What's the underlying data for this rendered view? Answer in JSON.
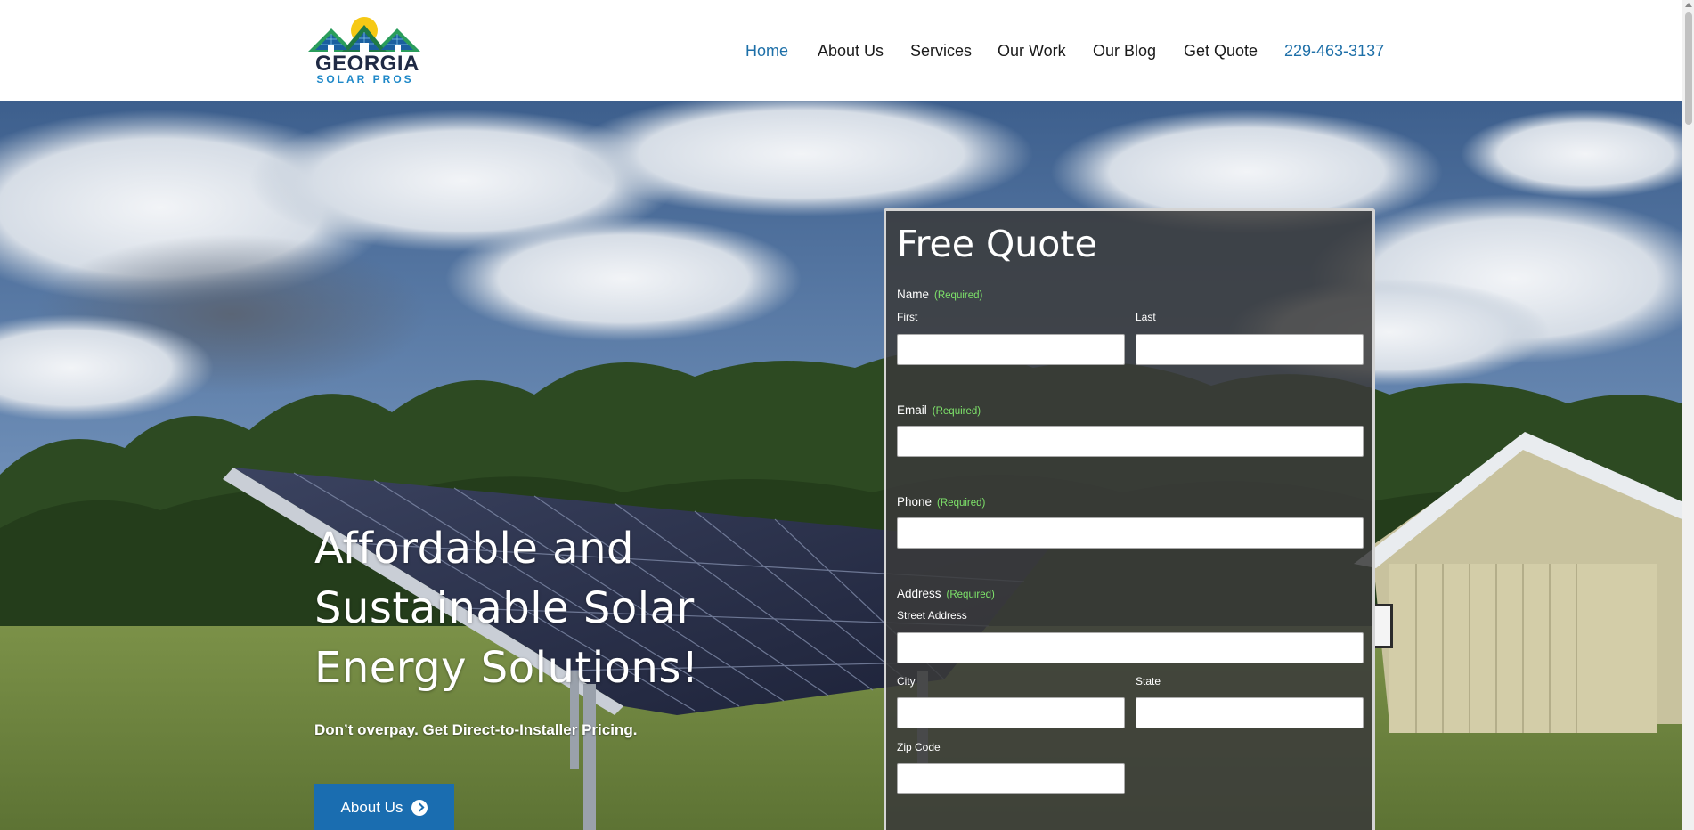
{
  "header": {
    "logo": {
      "main": "GEORGIA",
      "sub": "SOLAR PROS",
      "icon": "house-solar-logo-icon"
    },
    "nav": [
      {
        "label": "Home",
        "active": true
      },
      {
        "label": "About Us"
      },
      {
        "label": "Services"
      },
      {
        "label": "Our Work"
      },
      {
        "label": "Our Blog"
      },
      {
        "label": "Get Quote"
      }
    ],
    "phone": "229-463-3137"
  },
  "hero": {
    "title_lines": [
      "Affordable and",
      "Sustainable Solar",
      "Energy Solutions!"
    ],
    "subtitle": "Don’t overpay. Get Direct-to-Installer Pricing.",
    "button": {
      "label": "About Us",
      "icon": "arrow-right-circle-icon"
    }
  },
  "form": {
    "title": "Free Quote",
    "required_text": "(Required)",
    "name": {
      "label": "Name",
      "first": "First",
      "last": "Last"
    },
    "email": {
      "label": "Email"
    },
    "phone": {
      "label": "Phone"
    },
    "address": {
      "label": "Address",
      "street": "Street Address",
      "city": "City",
      "state": "State",
      "zip": "Zip Code"
    }
  },
  "colors": {
    "accent": "#1d6fa8",
    "button": "#1a6db0",
    "required": "#7ee36a",
    "form_panel": "#3a3a3a"
  }
}
